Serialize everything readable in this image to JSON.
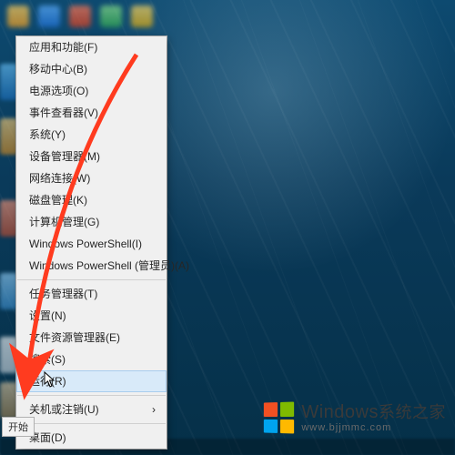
{
  "menu": {
    "items": [
      "应用和功能(F)",
      "移动中心(B)",
      "电源选项(O)",
      "事件查看器(V)",
      "系统(Y)",
      "设备管理器(M)",
      "网络连接(W)",
      "磁盘管理(K)",
      "计算机管理(G)",
      "Windows PowerShell(I)",
      "Windows PowerShell (管理员)(A)"
    ],
    "items2": [
      "任务管理器(T)",
      "设置(N)",
      "文件资源管理器(E)",
      "搜索(S)",
      "运行(R)"
    ],
    "items3": [
      "关机或注销(U)"
    ],
    "items4": [
      "桌面(D)"
    ],
    "highlighted": "运行(R)",
    "submenu_arrow": "›"
  },
  "tooltip": {
    "start": "开始"
  },
  "watermark": {
    "brand_en": "Windows",
    "brand_zh": "系统之家",
    "url": "www.bjjmmc.com"
  },
  "annotation": {
    "arrow_color": "#ff3b1f"
  }
}
